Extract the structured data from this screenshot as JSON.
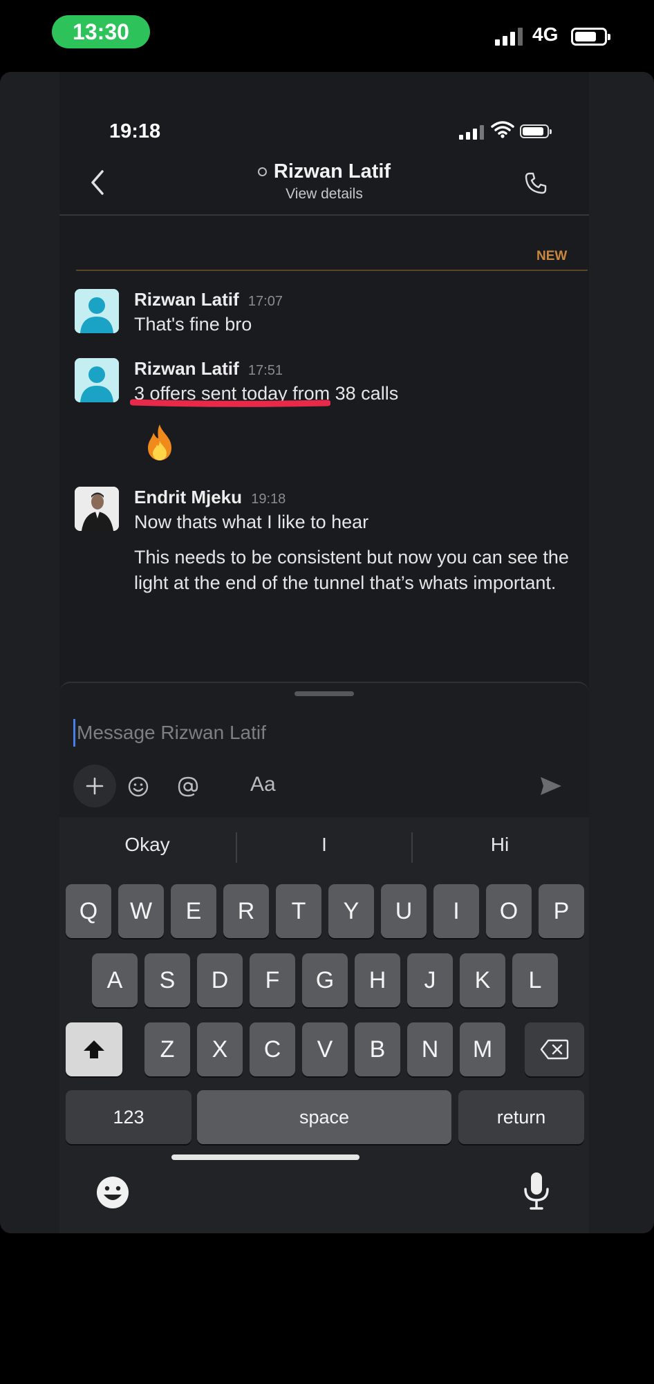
{
  "outer_status": {
    "time": "13:30",
    "network": "4G"
  },
  "inner_status": {
    "time": "19:18"
  },
  "header": {
    "name": "Rizwan Latif",
    "subtitle": "View details"
  },
  "divider": {
    "label": "NEW"
  },
  "messages": [
    {
      "name": "Rizwan Latif",
      "time": "17:07",
      "lines": [
        "That's fine bro"
      ]
    },
    {
      "name": "Rizwan Latif",
      "time": "17:51",
      "lines": [
        "3 offers sent today from 38 calls"
      ]
    },
    {
      "name": "Endrit Mjeku",
      "time": "19:18",
      "lines": [
        "Now thats what I like to hear",
        "This needs to be consistent but now you can see the light at the end of the tunnel that’s whats important."
      ]
    }
  ],
  "composer": {
    "placeholder": "Message Rizwan Latif",
    "format_label": "Aa"
  },
  "keyboard": {
    "suggestions": [
      "Okay",
      "I",
      "Hi"
    ],
    "row1": [
      "Q",
      "W",
      "E",
      "R",
      "T",
      "Y",
      "U",
      "I",
      "O",
      "P"
    ],
    "row2": [
      "A",
      "S",
      "D",
      "F",
      "G",
      "H",
      "J",
      "K",
      "L"
    ],
    "row3": [
      "Z",
      "X",
      "C",
      "V",
      "B",
      "N",
      "M"
    ],
    "numbers_label": "123",
    "space_label": "space",
    "return_label": "return"
  },
  "colors": {
    "accent_new": "#c9883e",
    "highlight_underline": "#e8294a",
    "status_pill": "#2ec35a"
  },
  "icons": [
    "back-icon",
    "call-icon",
    "presence-icon",
    "fire-icon",
    "plus-icon",
    "emoji-icon",
    "mention-icon",
    "send-icon",
    "shift-icon",
    "backspace-icon",
    "keyboard-emoji-icon",
    "mic-icon"
  ]
}
